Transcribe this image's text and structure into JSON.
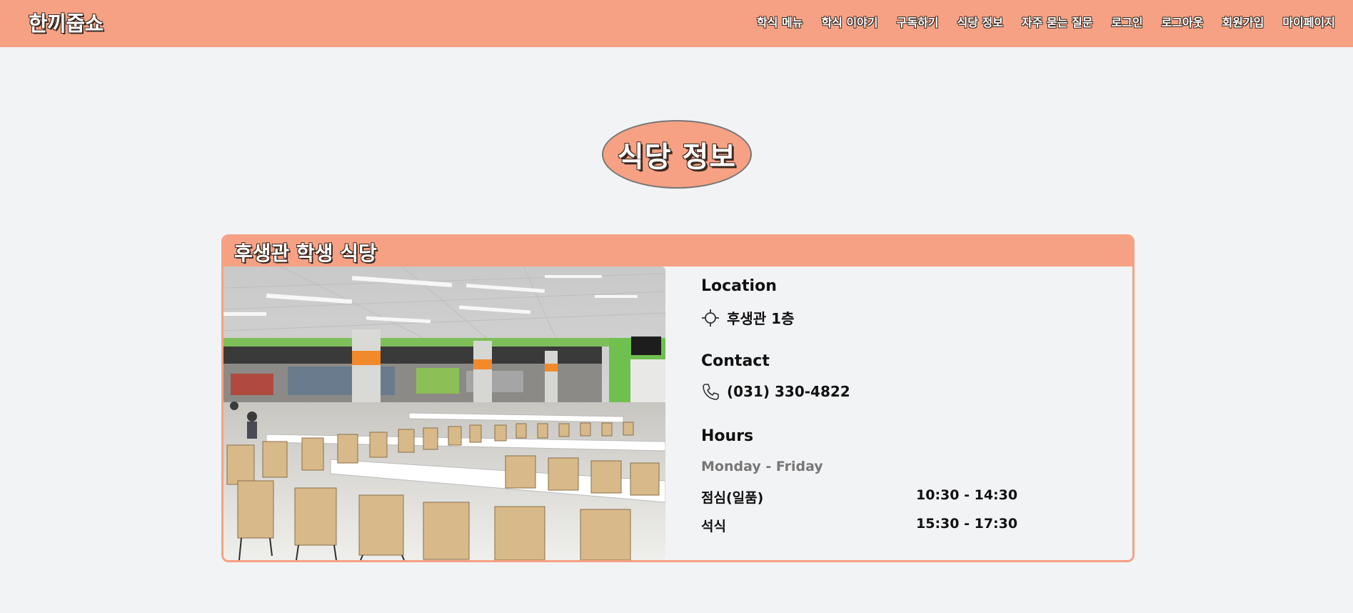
{
  "navbar": {
    "brand": "한끼줍쇼",
    "links": [
      "학식 메뉴",
      "학식 이야기",
      "구독하기",
      "식당 정보",
      "자주 묻는 질문",
      "로그인",
      "로그아웃",
      "회원가입",
      "마이페이지"
    ]
  },
  "page_title": "식당 정보",
  "restaurant": {
    "name": "후생관 학생 식당",
    "location_heading": "Location",
    "location": "후생관 1층",
    "contact_heading": "Contact",
    "phone": "(031) 330-4822",
    "hours_heading": "Hours",
    "days": "Monday - Friday",
    "meals": [
      {
        "name": "점심(일품)",
        "time": "10:30 - 14:30"
      },
      {
        "name": "석식",
        "time": "15:30 - 17:30"
      }
    ]
  },
  "icons": {
    "location": "crosshair-icon",
    "phone": "phone-icon"
  },
  "colors": {
    "accent": "#f6a183",
    "background": "#f2f3f5",
    "muted_text": "#777777"
  }
}
